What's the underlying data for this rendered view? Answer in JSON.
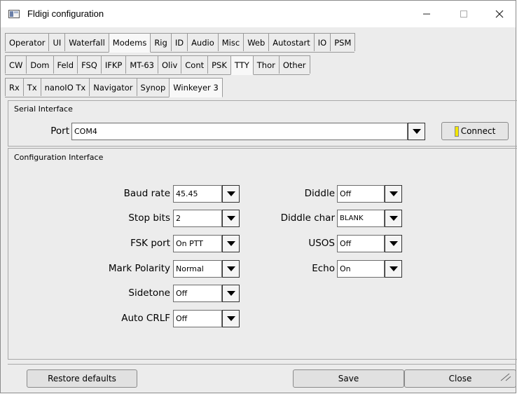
{
  "window": {
    "title": "Fldigi configuration",
    "min_icon": "minimize-icon",
    "max_icon": "maximize-icon",
    "close_icon": "close-icon"
  },
  "tabs_main": [
    "Operator",
    "UI",
    "Waterfall",
    "Modems",
    "Rig",
    "ID",
    "Audio",
    "Misc",
    "Web",
    "Autostart",
    "IO",
    "PSM"
  ],
  "tabs_modems": [
    "CW",
    "Dom",
    "Feld",
    "FSQ",
    "IFKP",
    "MT-63",
    "Oliv",
    "Cont",
    "PSK",
    "TTY",
    "Thor",
    "Other"
  ],
  "tabs_tty": [
    "Rx",
    "Tx",
    "nanoIO Tx",
    "Navigator",
    "Synop",
    "Winkeyer 3"
  ],
  "serial": {
    "title": "Serial Interface",
    "port_label": "Port",
    "port_value": "COM4",
    "connect_label": "Connect",
    "led_color": "#f2e600"
  },
  "config": {
    "title": "Configuration Interface",
    "baud_label": "Baud rate",
    "baud_value": "45.45",
    "stop_label": "Stop bits",
    "stop_value": "2",
    "fsk_label": "FSK port",
    "fsk_value": "On PTT",
    "mark_label": "Mark Polarity",
    "mark_value": "Normal",
    "sidetone_label": "Sidetone",
    "sidetone_value": "Off",
    "crlf_label": "Auto CRLF",
    "crlf_value": "Off",
    "diddle_label": "Diddle",
    "diddle_value": "Off",
    "diddlechar_label": "Diddle char",
    "diddlechar_value": "BLANK",
    "usos_label": "USOS",
    "usos_value": "Off",
    "echo_label": "Echo",
    "echo_value": "On"
  },
  "footer": {
    "restore_label": "Restore defaults",
    "save_label": "Save",
    "close_label": "Close"
  }
}
